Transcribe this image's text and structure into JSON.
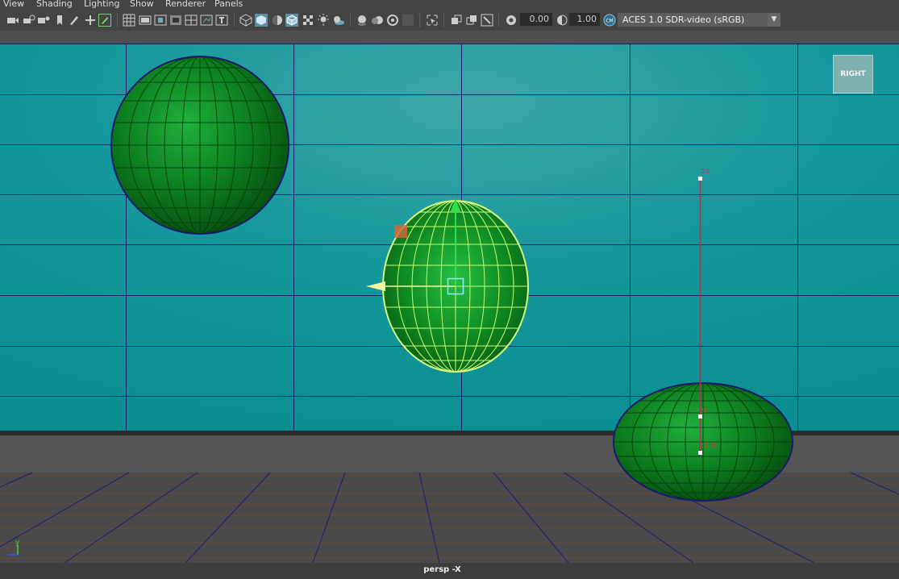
{
  "menu": {
    "items": [
      "View",
      "Shading",
      "Lighting",
      "Show",
      "Renderer",
      "Panels"
    ]
  },
  "toolbar": {
    "icons": [
      "camera-icon",
      "camera-attributes-icon",
      "bookmark-icon",
      "image-plane-icon",
      "grease-pencil-icon",
      "2d-pan-zoom-icon",
      "grid-icon",
      "film-gate-icon",
      "resolution-gate-icon",
      "gate-mask-icon",
      "field-chart-icon",
      "safe-action-icon",
      "safe-title-icon",
      "wireframe-icon",
      "smooth-shade-icon",
      "default-material-icon",
      "wireframe-on-shaded-icon",
      "textured-icon",
      "use-all-lights-icon",
      "shadows-icon",
      "screen-space-ao-icon",
      "motion-blur-icon",
      "anti-aliasing-icon",
      "depth-of-field-icon",
      "isolate-select-icon",
      "xray-icon",
      "xray-active-components-icon",
      "xray-joints-icon",
      "exposure-icon",
      "gamma-icon",
      "color-management-icon"
    ],
    "exposure_value": "0.00",
    "gamma_value": "1.00",
    "color_space": "ACES 1.0 SDR-video (sRGB)"
  },
  "viewport": {
    "view_cube_label": "RIGHT",
    "camera_label": "persp -X",
    "background_color": "#10969a",
    "grid_line_color": "#1c1c78",
    "sphere_color": "#0c7a1c",
    "selection_color": "#c8ff70",
    "measure_label_top": "20",
    "measure_label_bottom": "23.40",
    "axis_label": "y"
  }
}
